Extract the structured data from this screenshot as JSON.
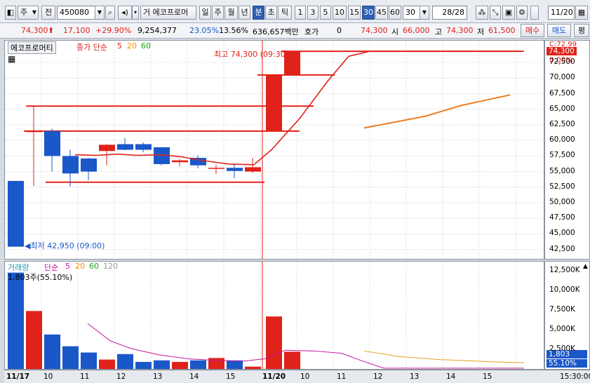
{
  "toolbar": {
    "type_label": "주",
    "jeon_label": "전",
    "code": "450080",
    "name": "에코프로머",
    "period_labels": [
      "일",
      "주",
      "월",
      "년",
      "분",
      "초",
      "틱"
    ],
    "selected_period": "분",
    "intervals": [
      "1",
      "3",
      "5",
      "10",
      "15",
      "30",
      "45",
      "60"
    ],
    "selected_interval": "30",
    "interval_value": "30",
    "count": "28",
    "count_total": "/28",
    "date": "11/20"
  },
  "quote": {
    "price": "74,300",
    "change": "17,100",
    "change_pct": "+29.90%",
    "volume": "9,254,377",
    "turnover": "23.05%",
    "ratio": "13.56%",
    "amount": "636,657백만",
    "hoga_label": "호가",
    "hoga_value": "0",
    "ask": "74,300",
    "open_label": "시",
    "open": "66,000",
    "high_label": "고",
    "high": "74,300",
    "low_label": "저",
    "low": "61,500",
    "buy": "매수",
    "sell": "매도",
    "eval": "평"
  },
  "price_panel": {
    "title": "에코프로머티",
    "legend": {
      "label": "종가 단순",
      "ma5": "5",
      "ma20": "20",
      "ma60": "60"
    },
    "high_note": "최고 74,300 (09:30)",
    "low_note": "최저 42,950 (09:00)",
    "current_tag": "74,300",
    "pct_tag": "0.00%",
    "top_tag": "C:72.99",
    "y_ticks": [
      "72,500",
      "70,000",
      "67,500",
      "65,000",
      "62,500",
      "60,000",
      "57,500",
      "55,000",
      "52,500",
      "50,000",
      "47,500",
      "45,000",
      "42,500"
    ]
  },
  "volume_panel": {
    "legend": {
      "label": "거래량",
      "ma_label": "단순",
      "ma5": "5",
      "ma20": "20",
      "ma60": "60",
      "ma120": "120"
    },
    "note": "1,803주(55.10%)",
    "current_tag": "1,803",
    "pct_tag": "55.10%",
    "y_ticks": [
      "12,500K",
      "10,000K",
      "7,500K",
      "5,000K",
      "2,500K"
    ]
  },
  "x_axis": {
    "labels": [
      "11/17",
      "10",
      "11",
      "12",
      "13",
      "14",
      "15",
      "11/20",
      "10",
      "11",
      "12",
      "13",
      "14",
      "15"
    ],
    "time": "15:30:00"
  },
  "chart_data": {
    "type": "candlestick",
    "x": [
      "11/17 09:00",
      "09:30",
      "10:00",
      "10:30",
      "11:00",
      "11:30",
      "12:00",
      "12:30",
      "13:00",
      "13:30",
      "14:00",
      "14:30",
      "15:00",
      "15:30",
      "11/20 09:00",
      "09:30"
    ],
    "open": [
      53500,
      61500,
      61500,
      57500,
      57100,
      58300,
      59400,
      59400,
      58900,
      56500,
      57200,
      55500,
      55600,
      55000,
      61500,
      70500
    ],
    "high": [
      53500,
      65500,
      61900,
      58500,
      57200,
      59400,
      60400,
      59700,
      58900,
      57000,
      57600,
      56100,
      56200,
      57200,
      70600,
      74300
    ],
    "low": [
      42950,
      52700,
      55000,
      52600,
      53600,
      56000,
      58400,
      58100,
      56000,
      55900,
      55500,
      54600,
      53900,
      54800,
      61500,
      70500
    ],
    "close": [
      42950,
      61500,
      57500,
      54700,
      55000,
      59300,
      58500,
      58500,
      56200,
      56800,
      56000,
      55600,
      55100,
      55700,
      70500,
      74300
    ],
    "volume_k": [
      12300,
      7400,
      4400,
      2900,
      2100,
      1200,
      1900,
      900,
      1100,
      900,
      1100,
      1400,
      1100,
      300,
      6700,
      2200
    ],
    "annotations": {
      "high": "74,300 (09:30)",
      "low": "42,950 (09:00)"
    }
  }
}
